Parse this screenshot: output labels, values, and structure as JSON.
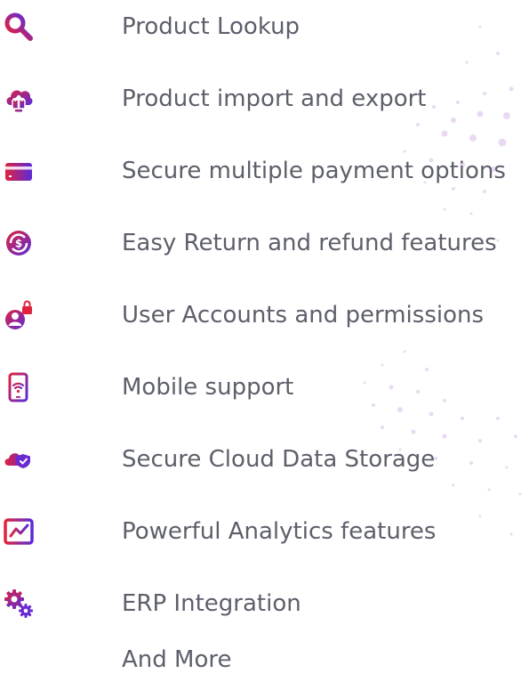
{
  "colors": {
    "text": "#5d5f6b",
    "gradient_start": "#e0223f",
    "gradient_end": "#5a2bd9"
  },
  "features": [
    {
      "label": "Product Lookup",
      "icon": "search-icon"
    },
    {
      "label": "Product import and export",
      "icon": "cloud-upload-icon"
    },
    {
      "label": "Secure multiple payment options",
      "icon": "credit-card-icon"
    },
    {
      "label": "Easy Return and refund features",
      "icon": "refund-icon"
    },
    {
      "label": "User Accounts and permissions",
      "icon": "user-lock-icon"
    },
    {
      "label": "Mobile support",
      "icon": "mobile-wifi-icon"
    },
    {
      "label": "Secure Cloud Data Storage",
      "icon": "cloud-shield-icon"
    },
    {
      "label": "Powerful Analytics features",
      "icon": "analytics-icon"
    },
    {
      "label": "ERP Integration",
      "icon": "gears-icon"
    },
    {
      "label": "And More",
      "icon": ""
    }
  ]
}
